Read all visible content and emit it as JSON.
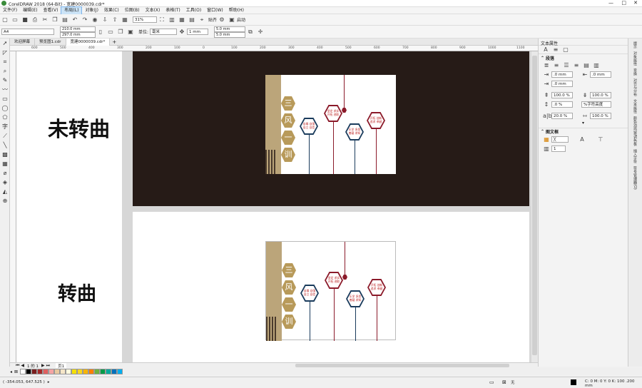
{
  "window": {
    "title": "CorelDRAW 2018 (64-Bit) - 宽建0000039.cdr*"
  },
  "menu": [
    "文件(F)",
    "编辑(E)",
    "查看(V)",
    "布局(L)",
    "对象(J)",
    "效果(C)",
    "位图(B)",
    "文本(X)",
    "表格(T)",
    "工具(O)",
    "窗口(W)",
    "帮助(H)"
  ],
  "toolbar": {
    "zoom": "31%",
    "snap": "贴齐",
    "launch": "启动"
  },
  "property_bar": {
    "page_size": "A4",
    "width": "210.0 mm",
    "height": "297.0 mm",
    "units_label": "单位:",
    "units": "毫米",
    "nudge": "1 mm",
    "dup_x": "5.0 mm",
    "dup_y": "5.0 mm"
  },
  "tabs": [
    "欢迎屏幕",
    "预览图1.cdr",
    "宽建0000039.cdr*"
  ],
  "ruler_ticks": [
    "600",
    "500",
    "400",
    "300",
    "200",
    "100",
    "0",
    "100",
    "200",
    "300",
    "400",
    "500",
    "600",
    "700",
    "800",
    "900",
    "1000",
    "1100"
  ],
  "canvas": {
    "label_unconverted": "未转曲",
    "label_converted": "转曲"
  },
  "design": {
    "chars": [
      "三",
      "风",
      "一",
      "训"
    ],
    "hex_texts": [
      "自尊 自强 自立 自信",
      "坚定 求实 开拓 进取",
      "乐学 多思 善疑 求知",
      "开拓 创新 追求 卓越"
    ]
  },
  "docpanel": {
    "title": "文本属性",
    "section_para": "段落",
    "section_frame": "图文框",
    "indent1": ".0 mm",
    "indent2": ".0 mm",
    "indent3": ".0 mm",
    "spacing1": "100.0 %",
    "spacing2": "100.0 %",
    "spacing3": ".0 %",
    "spacing_unit": "%字符高度",
    "char_spacing": "20.0 %",
    "word_spacing": "100.0 %",
    "columns": "1"
  },
  "sidetabs": [
    "提示",
    "对象属性",
    "变换",
    "对齐与分布",
    "文本属性",
    "颜色泊坞窗/调色板",
    "插入字符",
    "符号管理器(O)"
  ],
  "pagebar": {
    "page_of": "1 的 1",
    "page_tab": "页1"
  },
  "palette": [
    "#ffffff",
    "#000000",
    "#7b1e1e",
    "#a52a2a",
    "#e06060",
    "#f4a3a3",
    "#e8c9a0",
    "#f5e6c8",
    "#fffbe0",
    "#f5e000",
    "#f9d71c",
    "#f7b500",
    "#ff7f00",
    "#6db33f",
    "#009b48",
    "#00a99d",
    "#0071bc",
    "#00aeef"
  ],
  "status": {
    "coords": "( -354.053, 647.525 )",
    "color": "C: 0 M: 0 Y: 0 K: 100  .200 mm",
    "none": "无"
  }
}
